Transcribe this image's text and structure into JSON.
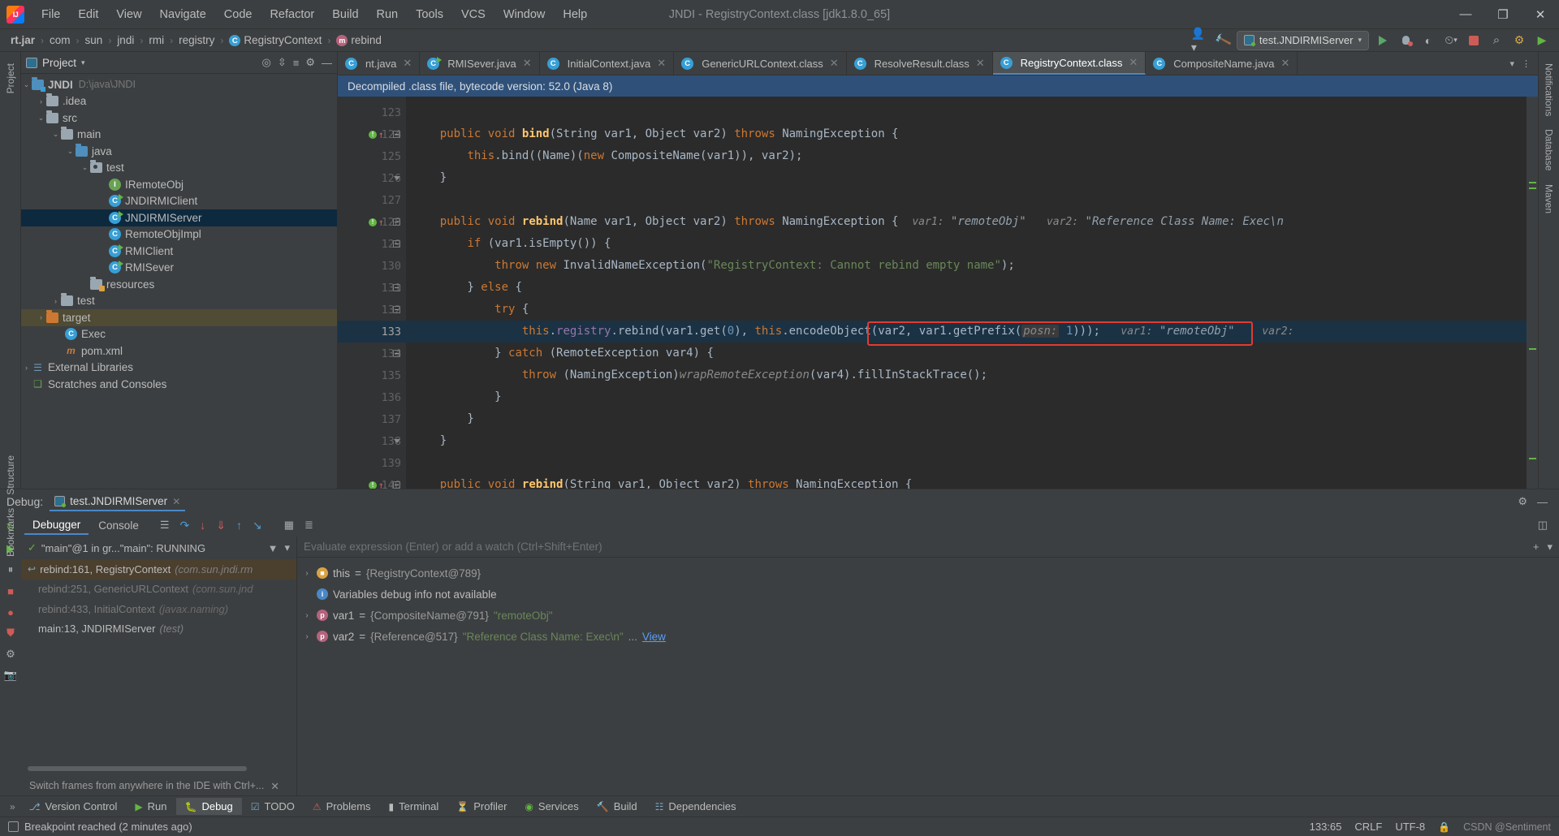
{
  "window": {
    "title": "JNDI - RegistryContext.class [jdk1.8.0_65]",
    "minimize": "—",
    "maximize": "❐",
    "close": "✕"
  },
  "menu": [
    {
      "label": "File"
    },
    {
      "label": "Edit"
    },
    {
      "label": "View"
    },
    {
      "label": "Navigate"
    },
    {
      "label": "Code"
    },
    {
      "label": "Refactor"
    },
    {
      "label": "Build"
    },
    {
      "label": "Run"
    },
    {
      "label": "Tools"
    },
    {
      "label": "VCS"
    },
    {
      "label": "Window"
    },
    {
      "label": "Help"
    }
  ],
  "breadcrumb": {
    "items": [
      {
        "label": "rt.jar",
        "bold": true,
        "icon": ""
      },
      {
        "label": "com",
        "icon": ""
      },
      {
        "label": "sun",
        "icon": ""
      },
      {
        "label": "jndi",
        "icon": ""
      },
      {
        "label": "rmi",
        "icon": ""
      },
      {
        "label": "registry",
        "icon": ""
      },
      {
        "label": "RegistryContext",
        "icon": "class-icon",
        "glyph": "C"
      },
      {
        "label": "rebind",
        "icon": "method-icon",
        "glyph": "m"
      }
    ],
    "separator": "›"
  },
  "toolbar": {
    "run_config": "test.JNDIRMIServer",
    "run_config_caret": "▾",
    "avatar_icon": "user-icon",
    "hammer_icon": "build-icon",
    "run_icon": "run-icon",
    "debug_icon": "debug-icon",
    "coverage_icon": "coverage-icon",
    "more_icon": "▾",
    "stop_icon": "stop-icon",
    "search_icon": "⌕",
    "plugin_icon": "⚙",
    "updates_icon": "▶"
  },
  "left_rail": [
    {
      "label": "Project"
    },
    {
      "label": "Structure"
    },
    {
      "label": "Bookmarks"
    }
  ],
  "right_rail": [
    {
      "label": "Notifications"
    },
    {
      "label": "Database"
    },
    {
      "label": "Maven"
    }
  ],
  "project_panel": {
    "title": "Project",
    "title_caret": "▾",
    "actions": [
      "target-icon",
      "collapse-icon",
      "expand-icon",
      "settings-icon",
      "hide-icon"
    ],
    "tree": [
      {
        "indent": 0,
        "arrow": "⌄",
        "icon": "module-folder",
        "label": "JNDI",
        "bold": true,
        "sub": "D:\\java\\JNDI",
        "sel": false
      },
      {
        "indent": 1,
        "arrow": "›",
        "icon": "folder",
        "label": ".idea",
        "sub": "",
        "sel": false
      },
      {
        "indent": 1,
        "arrow": "⌄",
        "icon": "folder",
        "label": "src",
        "sub": "",
        "sel": false
      },
      {
        "indent": 2,
        "arrow": "⌄",
        "icon": "folder",
        "label": "main",
        "sub": "",
        "sel": false
      },
      {
        "indent": 3,
        "arrow": "⌄",
        "icon": "source-folder",
        "label": "java",
        "sub": "",
        "sel": false
      },
      {
        "indent": 4,
        "arrow": "⌄",
        "icon": "package-folder",
        "label": "test",
        "sub": "",
        "sel": false
      },
      {
        "indent": 5,
        "arrow": "",
        "icon": "interface",
        "label": "IRemoteObj",
        "sub": "",
        "sel": false
      },
      {
        "indent": 5,
        "arrow": "",
        "icon": "class-runnable",
        "label": "JNDIRMIClient",
        "sub": "",
        "sel": false
      },
      {
        "indent": 5,
        "arrow": "",
        "icon": "class-runnable",
        "label": "JNDIRMIServer",
        "sub": "",
        "sel": true
      },
      {
        "indent": 5,
        "arrow": "",
        "icon": "class",
        "label": "RemoteObjImpl",
        "sub": "",
        "sel": false
      },
      {
        "indent": 5,
        "arrow": "",
        "icon": "class-runnable",
        "label": "RMIClient",
        "sub": "",
        "sel": false
      },
      {
        "indent": 5,
        "arrow": "",
        "icon": "class-runnable",
        "label": "RMISever",
        "sub": "",
        "sel": false
      },
      {
        "indent": 4,
        "arrow": "",
        "icon": "resource-folder",
        "label": "resources",
        "sub": "",
        "sel": false
      },
      {
        "indent": 2,
        "arrow": "›",
        "icon": "folder",
        "label": "test",
        "sub": "",
        "sel": false
      },
      {
        "indent": 1,
        "arrow": "›",
        "icon": "target-folder",
        "label": "target",
        "sub": "",
        "sel": false,
        "selOlive": true
      },
      {
        "indent": 2,
        "arrow": "",
        "icon": "class",
        "label": "Exec",
        "sub": "",
        "sel": false
      },
      {
        "indent": 2,
        "arrow": "",
        "icon": "maven",
        "label": "pom.xml",
        "sub": "",
        "sel": false
      },
      {
        "indent": 0,
        "arrow": "›",
        "icon": "library",
        "label": "External Libraries",
        "sub": "",
        "sel": false
      },
      {
        "indent": 0,
        "arrow": "",
        "icon": "scratch",
        "label": "Scratches and Consoles",
        "sub": "",
        "sel": false
      }
    ]
  },
  "editor": {
    "tabs": [
      {
        "label": "nt.java",
        "icon": "java-class",
        "active": false,
        "truncated": true
      },
      {
        "label": "RMISever.java",
        "icon": "java-runnable",
        "active": false
      },
      {
        "label": "InitialContext.java",
        "icon": "java-class",
        "active": false
      },
      {
        "label": "GenericURLContext.class",
        "icon": "java-class",
        "active": false
      },
      {
        "label": "ResolveResult.class",
        "icon": "java-class",
        "active": false
      },
      {
        "label": "RegistryContext.class",
        "icon": "java-class",
        "active": true
      },
      {
        "label": "CompositeName.java",
        "icon": "java-class",
        "active": false
      }
    ],
    "tab_close": "✕",
    "tab_overflow": "▾",
    "tab_more": "⋮",
    "notice": "Decompiled .class file, bytecode version: 52.0 (Java 8)",
    "lines": [
      {
        "num": "123",
        "bp": false,
        "fold": "",
        "html": ""
      },
      {
        "num": "124",
        "bp": true,
        "fold": "minus",
        "html": "    <span class=\"kw\">public</span> <span class=\"kw\">void</span> <span class=\"mn\">bind</span>(String var1, Object var2) <span class=\"kw\">throws</span> NamingException {"
      },
      {
        "num": "125",
        "bp": false,
        "fold": "",
        "html": "        <span class=\"kw\">this</span>.bind((Name)(<span class=\"kw\">new</span> CompositeName(var1)), var2);"
      },
      {
        "num": "126",
        "bp": false,
        "fold": "tri",
        "html": "    }"
      },
      {
        "num": "127",
        "bp": false,
        "fold": "",
        "html": ""
      },
      {
        "num": "128",
        "bp": true,
        "fold": "minus",
        "html": "    <span class=\"kw\">public</span> <span class=\"kw\">void</span> <span class=\"mn\">rebind</span>(Name var1, Object var2) <span class=\"kw\">throws</span> NamingException {  <span class=\"hint\">var1:</span> <span class=\"hint-v\">\"remoteObj\"</span>   <span class=\"hint\">var2:</span> <span class=\"hint-v\">\"Reference Class Name: Exec\\n</span>"
      },
      {
        "num": "129",
        "bp": false,
        "fold": "minus",
        "html": "        <span class=\"kw\">if</span> (var1.isEmpty()) {"
      },
      {
        "num": "130",
        "bp": false,
        "fold": "",
        "html": "            <span class=\"kw\">throw</span> <span class=\"kw\">new</span> InvalidNameException(<span class=\"str\">\"RegistryContext: Cannot rebind empty name\"</span>);"
      },
      {
        "num": "131",
        "bp": false,
        "fold": "minus",
        "html": "        } <span class=\"kw\">else</span> {"
      },
      {
        "num": "132",
        "bp": false,
        "fold": "minus",
        "html": "            <span class=\"kw\">try</span> {"
      },
      {
        "num": "133",
        "bp": false,
        "fold": "",
        "hl": true,
        "html": "                <span class=\"kw\">this</span>.<span class=\"fld\">registry</span>.rebind(var1.get(<span class=\"num\">0</span>), <span class=\"kw\">this</span>.encodeObject(var2, var1.getPrefix(<span class=\"param-hint\">posn:</span> <span class=\"num\">1</span>)));   <span class=\"hint\">var1:</span> <span class=\"hint-v\">\"remoteObj\"</span>    <span class=\"hint\">var2:</span>"
      },
      {
        "num": "134",
        "bp": false,
        "fold": "minus",
        "html": "            } <span class=\"kw\">catch</span> (RemoteException var4) {"
      },
      {
        "num": "135",
        "bp": false,
        "fold": "",
        "html": "                <span class=\"kw\">throw</span> (NamingException)<span class=\"ital\">wrapRemoteException</span>(var4).fillInStackTrace();"
      },
      {
        "num": "136",
        "bp": false,
        "fold": "",
        "html": "            }"
      },
      {
        "num": "137",
        "bp": false,
        "fold": "",
        "html": "        }"
      },
      {
        "num": "138",
        "bp": false,
        "fold": "tri",
        "html": "    }"
      },
      {
        "num": "139",
        "bp": false,
        "fold": "",
        "html": ""
      },
      {
        "num": "140",
        "bp": true,
        "fold": "minus",
        "html": "    <span class=\"kw\">public</span> <span class=\"kw\">void</span> <span class=\"mn\">rebind</span>(String var1, Object var2) <span class=\"kw\">throws</span> NamingException {"
      }
    ]
  },
  "debug": {
    "label": "Debug:",
    "session_tab": "test.JNDIRMIServer",
    "session_close": "✕",
    "settings_icon": "⚙",
    "hide_icon": "—",
    "subtabs": [
      {
        "label": "Debugger",
        "active": true
      },
      {
        "label": "Console",
        "active": false
      }
    ],
    "step_icons": [
      "step-over-icon",
      "step-into-icon",
      "force-step-into-icon",
      "step-out-icon",
      "run-to-cursor-icon",
      "evaluate-icon",
      "mute-breakpoints-icon"
    ],
    "rail_icons": [
      "rerun-icon",
      "resume-icon",
      "pause-icon",
      "stop-icon",
      "breakpoints-icon",
      "mute-icon",
      "settings-icon",
      "camera-icon"
    ],
    "thread": {
      "status_icon": "check-icon",
      "text": "\"main\"@1 in gr...\"main\": RUNNING",
      "filter_icon": "filter-icon",
      "dropdown_icon": "▾"
    },
    "frames": [
      {
        "label": "rebind:161, RegistryContext",
        "pkg": "(com.sun.jndi.rm",
        "sel": true,
        "dim": false,
        "ret": true
      },
      {
        "label": "rebind:251, GenericURLContext",
        "pkg": "(com.sun.jnd",
        "sel": false,
        "dim": true,
        "ret": false
      },
      {
        "label": "rebind:433, InitialContext",
        "pkg": "(javax.naming)",
        "sel": false,
        "dim": true,
        "ret": false
      },
      {
        "label": "main:13, JNDIRMIServer",
        "pkg": "(test)",
        "sel": false,
        "dim": false,
        "ret": false
      }
    ],
    "tip": "Switch frames from anywhere in the IDE with Ctrl+...",
    "tip_close": "✕",
    "evaluate_placeholder": "Evaluate expression (Enter) or add a watch (Ctrl+Shift+Enter)",
    "evaluate_add": "+",
    "evaluate_caret": "▾",
    "variables": [
      {
        "caret": "›",
        "icon": "field",
        "glyph": "",
        "name": "this",
        "eq": " = ",
        "obj": "{RegistryContext@789}",
        "str": "",
        "link": "",
        "type": "field"
      },
      {
        "caret": "",
        "icon": "info",
        "glyph": "i",
        "name": "",
        "eq": "",
        "obj": "",
        "str": "",
        "link": "",
        "info": "Variables debug info not available",
        "type": "info"
      },
      {
        "caret": "›",
        "icon": "param",
        "glyph": "p",
        "name": "var1",
        "eq": " = ",
        "obj": "{CompositeName@791}",
        "str": "\"remoteObj\"",
        "link": "",
        "type": "param"
      },
      {
        "caret": "›",
        "icon": "param",
        "glyph": "p",
        "name": "var2",
        "eq": " = ",
        "obj": "{Reference@517}",
        "str": "\"Reference Class Name: Exec\\n\"",
        "dots": "...",
        "link": "View",
        "type": "param"
      }
    ]
  },
  "bottom_toolbar": {
    "more": "»",
    "buttons": [
      {
        "label": "Version Control",
        "icon": "vcs-icon",
        "active": false
      },
      {
        "label": "Run",
        "icon": "run-icon",
        "active": false
      },
      {
        "label": "Debug",
        "icon": "debug-icon",
        "active": true
      },
      {
        "label": "TODO",
        "icon": "todo-icon",
        "active": false
      },
      {
        "label": "Problems",
        "icon": "problems-icon",
        "active": false
      },
      {
        "label": "Terminal",
        "icon": "terminal-icon",
        "active": false
      },
      {
        "label": "Profiler",
        "icon": "profiler-icon",
        "active": false
      },
      {
        "label": "Services",
        "icon": "services-icon",
        "active": false
      },
      {
        "label": "Build",
        "icon": "build-icon",
        "active": false
      },
      {
        "label": "Dependencies",
        "icon": "dependencies-icon",
        "active": false
      }
    ]
  },
  "statusbar": {
    "message": "Breakpoint reached (2 minutes ago)",
    "caret_position": "133:65",
    "line_separator": "CRLF",
    "encoding": "UTF-8",
    "watermark": "CSDN @Sentiment"
  }
}
